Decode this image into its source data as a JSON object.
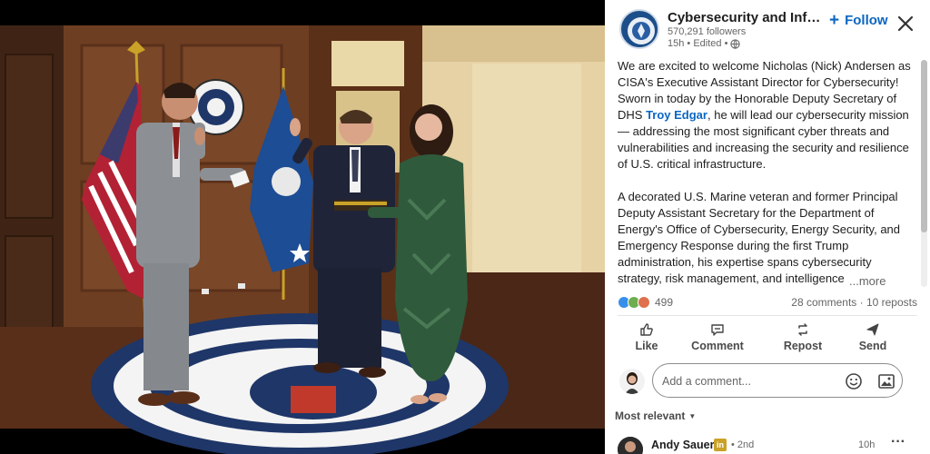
{
  "post": {
    "org_name": "Cybersecurity and Infra...",
    "followers": "570,291 followers",
    "meta": "15h • Edited •",
    "follow_label": "Follow",
    "paragraph1_before": "We are excited to welcome Nicholas (Nick) Andersen as CISA's Executive Assistant Director for Cybersecurity! Sworn in today by the Honorable Deputy Secretary of DHS ",
    "mention": "Troy Edgar",
    "paragraph1_after": ", he will lead our cybersecurity mission — addressing the most significant cyber threats and vulnerabilities and increasing the security and resilience of U.S. critical infrastructure.",
    "paragraph2": "A decorated U.S. Marine veteran and former Principal Deputy Assistant Secretary for the Department of Energy's Office of Cybersecurity, Energy Security, and Emergency Response during the first Trump administration, his expertise spans cybersecurity strategy, risk management, and intelligence",
    "more_label": "...more",
    "reaction_count": "499",
    "comments_reposts": "28 comments · 10 reposts"
  },
  "actions": {
    "like": "Like",
    "comment": "Comment",
    "repost": "Repost",
    "send": "Send"
  },
  "composer": {
    "placeholder": "Add a comment..."
  },
  "comments": {
    "sort_label": "Most relevant",
    "first": {
      "name": "Andy Sauer",
      "badge": "in",
      "degree": "• 2nd",
      "time": "10h",
      "more": "···"
    }
  },
  "icons": {
    "globe": "globe-icon",
    "close": "close-icon",
    "like": "thumbs-up-icon",
    "comment": "speech-bubble-icon",
    "repost": "repost-arrows-icon",
    "send": "paper-plane-icon",
    "emoji": "smiley-icon",
    "image": "image-icon"
  },
  "colors": {
    "accent": "#0a66c2",
    "like": "#378fe9",
    "celebrate": "#6dae4f",
    "love": "#df704d"
  }
}
